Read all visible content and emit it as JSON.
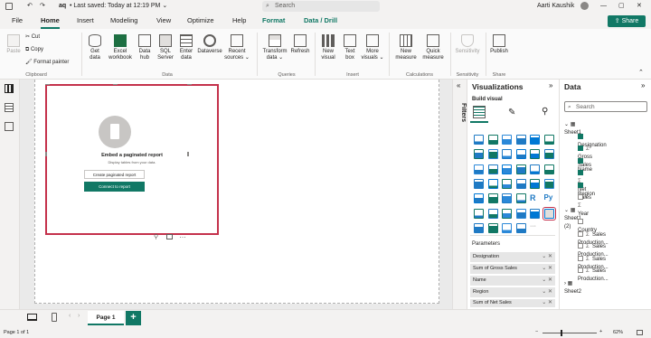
{
  "titlebar": {
    "file_name": "aq",
    "saved": "Last saved: Today at 12:19 PM",
    "search_placeholder": "Search",
    "user": "Aarti Kaushik"
  },
  "menu": {
    "items": [
      "File",
      "Home",
      "Insert",
      "Modeling",
      "View",
      "Optimize",
      "Help",
      "Format",
      "Data / Drill"
    ],
    "active": "Home",
    "share": "Share"
  },
  "ribbon": {
    "clipboard": {
      "paste": "Paste",
      "cut": "Cut",
      "copy": "Copy",
      "format_painter": "Format painter",
      "group": "Clipboard"
    },
    "data": {
      "get_data": [
        "Get",
        "data"
      ],
      "excel": [
        "Excel",
        "workbook"
      ],
      "hub": [
        "Data",
        "hub"
      ],
      "sql": [
        "SQL",
        "Server"
      ],
      "enter": [
        "Enter",
        "data"
      ],
      "dataverse": "Dataverse",
      "recent": [
        "Recent",
        "sources"
      ],
      "group": "Data"
    },
    "queries": {
      "transform": [
        "Transform",
        "data"
      ],
      "refresh": "Refresh",
      "group": "Queries"
    },
    "insert": {
      "new_visual": [
        "New",
        "visual"
      ],
      "text_box": [
        "Text",
        "box"
      ],
      "more": [
        "More",
        "visuals"
      ],
      "group": "Insert"
    },
    "calculations": {
      "new_measure": [
        "New",
        "measure"
      ],
      "quick_measure": [
        "Quick",
        "measure"
      ],
      "group": "Calculations"
    },
    "sensitivity": {
      "label": "Sensitivity",
      "group": "Sensitivity"
    },
    "share": {
      "publish": "Publish",
      "group": "Share"
    }
  },
  "visual": {
    "title": "Embed a paginated report",
    "subtitle": "Display tables from your data.",
    "create_btn": "Create paginated report",
    "connect_btn": "Connect to report"
  },
  "filters": {
    "label": "Filters"
  },
  "visualizations": {
    "title": "Visualizations",
    "build_visual": "Build visual",
    "parameters_label": "Parameters",
    "fields": [
      "Designation",
      "Sum of Gross Sales",
      "Name",
      "Region",
      "Sum of Net Sales"
    ]
  },
  "data_pane": {
    "title": "Data",
    "search_placeholder": "Search",
    "tables": [
      {
        "name": "Sheet1",
        "fields": [
          {
            "name": "Designation",
            "checked": true,
            "sigma": false
          },
          {
            "name": "Gross Sales",
            "checked": true,
            "sigma": true
          },
          {
            "name": "Name",
            "checked": true,
            "sigma": false
          },
          {
            "name": "Net Sales",
            "checked": true,
            "sigma": true
          },
          {
            "name": "Region",
            "checked": true,
            "sigma": false
          },
          {
            "name": "Year",
            "checked": false,
            "sigma": true
          }
        ]
      },
      {
        "name": "Sheet1 (2)",
        "fields": [
          {
            "name": "Country",
            "checked": false,
            "sigma": false
          },
          {
            "name": "Sales Production...",
            "checked": false,
            "sigma": true
          },
          {
            "name": "Sales Production...",
            "checked": false,
            "sigma": true
          },
          {
            "name": "Sales Production...",
            "checked": false,
            "sigma": true
          },
          {
            "name": "Sales Production...",
            "checked": false,
            "sigma": true
          }
        ]
      },
      {
        "name": "Sheet2",
        "fields": []
      }
    ]
  },
  "tabs": {
    "page": "Page 1",
    "add": "+"
  },
  "status": {
    "page_info": "Page 1 of 1",
    "zoom": "62%"
  },
  "colors": {
    "accent": "#117865",
    "highlight": "#c4314b"
  }
}
